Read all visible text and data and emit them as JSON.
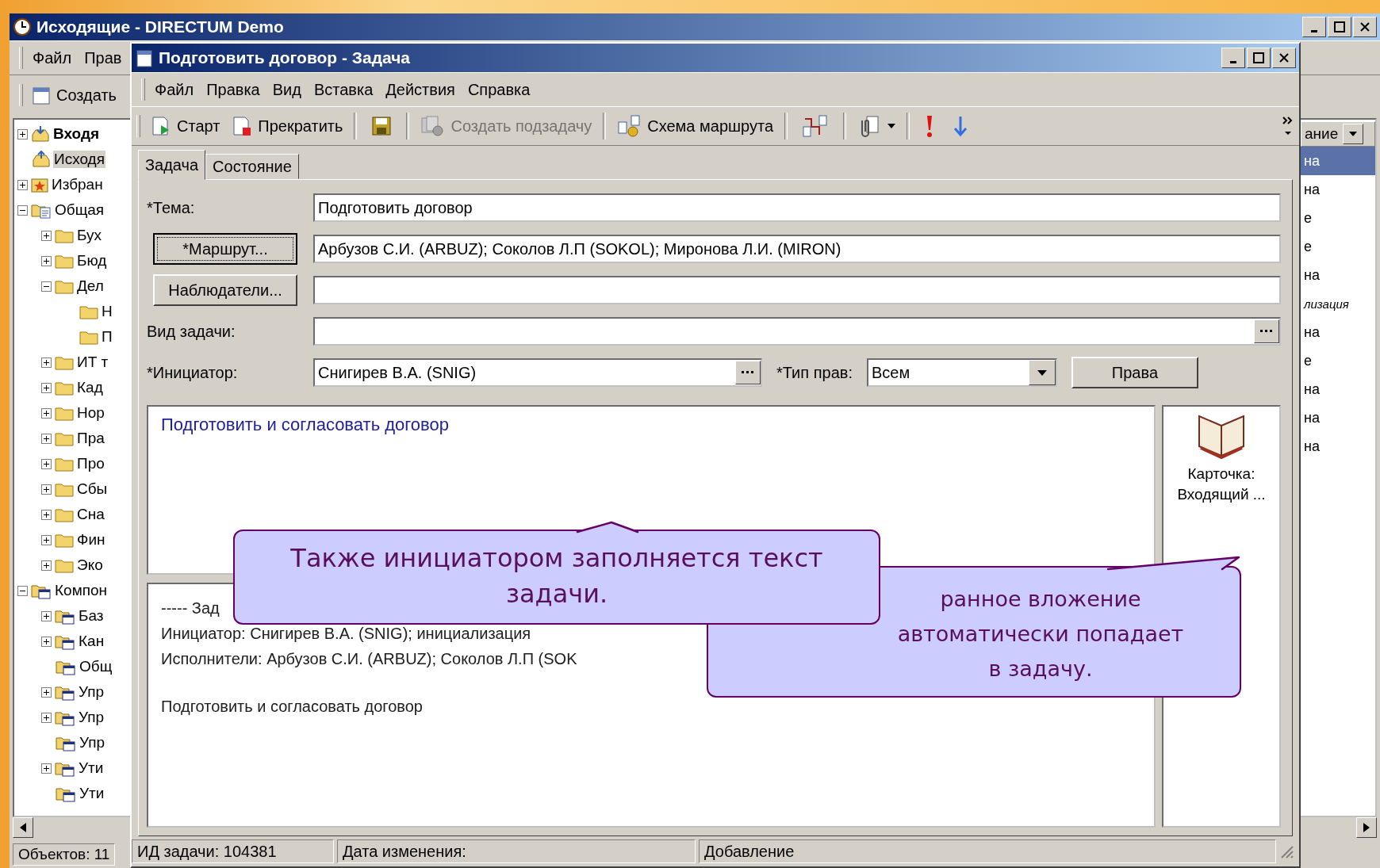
{
  "main_window": {
    "title": "Исходящие - DIRECTUM Demo",
    "menu": [
      "Файл",
      "Прав"
    ],
    "toolbar_button": "Создать",
    "tree": [
      {
        "label": "Входя",
        "kind": "inbox",
        "expanded": false,
        "bold": true,
        "selected": false
      },
      {
        "label": "Исходя",
        "kind": "outbox",
        "bold": false,
        "selected": true
      },
      {
        "label": "Избран",
        "kind": "favorites",
        "expanded": false,
        "bold": false,
        "selected": false
      },
      {
        "label": "Общая",
        "kind": "shared",
        "expanded": true,
        "bold": false,
        "selected": false,
        "children": [
          {
            "label": "Бух",
            "kind": "folder",
            "expanded": false,
            "bold": false,
            "selected": false
          },
          {
            "label": "Бюд",
            "kind": "folder",
            "expanded": false,
            "bold": false,
            "selected": false
          },
          {
            "label": "Дел",
            "kind": "folder",
            "expanded": true,
            "bold": false,
            "selected": false,
            "children": [
              {
                "label": "Н",
                "kind": "folder",
                "bold": false,
                "selected": false
              },
              {
                "label": "П",
                "kind": "folder",
                "bold": false,
                "selected": false
              }
            ]
          },
          {
            "label": "ИТ т",
            "kind": "folder",
            "expanded": false,
            "bold": false,
            "selected": false
          },
          {
            "label": "Кад",
            "kind": "folder",
            "expanded": false,
            "bold": false,
            "selected": false
          },
          {
            "label": "Нор",
            "kind": "folder",
            "expanded": false,
            "bold": false,
            "selected": false
          },
          {
            "label": "Пра",
            "kind": "folder",
            "expanded": false,
            "bold": false,
            "selected": false
          },
          {
            "label": "Про",
            "kind": "folder",
            "expanded": false,
            "bold": false,
            "selected": false
          },
          {
            "label": "Сбы",
            "kind": "folder",
            "expanded": false,
            "bold": false,
            "selected": false
          },
          {
            "label": "Сна",
            "kind": "folder",
            "expanded": false,
            "bold": false,
            "selected": false
          },
          {
            "label": "Фин",
            "kind": "folder",
            "expanded": false,
            "bold": false,
            "selected": false
          },
          {
            "label": "Эко",
            "kind": "folder",
            "expanded": false,
            "bold": false,
            "selected": false
          }
        ]
      },
      {
        "label": "Компон",
        "kind": "component",
        "expanded": true,
        "bold": false,
        "selected": false,
        "children": [
          {
            "label": "Баз",
            "kind": "component",
            "expanded": false,
            "bold": false,
            "selected": false
          },
          {
            "label": "Кан",
            "kind": "component",
            "expanded": false,
            "bold": false,
            "selected": false
          },
          {
            "label": "Общ",
            "kind": "component",
            "bold": false,
            "selected": false
          },
          {
            "label": "Упр",
            "kind": "component",
            "expanded": false,
            "bold": false,
            "selected": false
          },
          {
            "label": "Упр",
            "kind": "component",
            "expanded": false,
            "bold": false,
            "selected": false
          },
          {
            "label": "Упр",
            "kind": "component",
            "bold": false,
            "selected": false
          },
          {
            "label": "Ути",
            "kind": "component",
            "expanded": false,
            "bold": false,
            "selected": false
          },
          {
            "label": "Ути",
            "kind": "component",
            "bold": false,
            "selected": false
          }
        ]
      }
    ],
    "list": {
      "column_header": "ание",
      "rows": [
        {
          "text": "на",
          "selected": true,
          "italic": false
        },
        {
          "text": "на",
          "selected": false,
          "italic": false
        },
        {
          "text": "е",
          "selected": false,
          "italic": false
        },
        {
          "text": "е",
          "selected": false,
          "italic": false
        },
        {
          "text": "на",
          "selected": false,
          "italic": false
        },
        {
          "text": "лизация",
          "selected": false,
          "italic": true
        },
        {
          "text": "на",
          "selected": false,
          "italic": false
        },
        {
          "text": "е",
          "selected": false,
          "italic": false
        },
        {
          "text": "на",
          "selected": false,
          "italic": false
        },
        {
          "text": "на",
          "selected": false,
          "italic": false
        },
        {
          "text": "на",
          "selected": false,
          "italic": false
        }
      ]
    },
    "status": "Объектов: 11"
  },
  "task_window": {
    "title": "Подготовить договор - Задача",
    "menu": [
      "Файл",
      "Правка",
      "Вид",
      "Вставка",
      "Действия",
      "Справка"
    ],
    "toolbar": [
      {
        "kind": "button",
        "label": "Старт",
        "disabled": false
      },
      {
        "kind": "button",
        "label": "Прекратить",
        "disabled": false
      },
      {
        "kind": "separator"
      },
      {
        "kind": "icon",
        "disabled": false
      },
      {
        "kind": "separator"
      },
      {
        "kind": "button",
        "label": "Создать подзадачу",
        "disabled": true
      },
      {
        "kind": "separator"
      },
      {
        "kind": "button",
        "label": "Схема маршрута",
        "disabled": false
      },
      {
        "kind": "separator"
      },
      {
        "kind": "icon",
        "disabled": false
      },
      {
        "kind": "separator"
      },
      {
        "kind": "dropdown",
        "disabled": false
      },
      {
        "kind": "separator"
      },
      {
        "kind": "icon",
        "disabled": false
      },
      {
        "kind": "icon",
        "disabled": false
      }
    ],
    "tabs": [
      {
        "label": "Задача",
        "selected": true
      },
      {
        "label": "Состояние",
        "selected": false
      }
    ],
    "form": {
      "subject_label": "*Тема:",
      "subject": "Подготовить договор",
      "route_button": "*Маршрут...",
      "route": "Арбузов С.И. (ARBUZ); Соколов Л.П (SOKOL); Миронова Л.И. (MIRON)",
      "observers_button": "Наблюдатели...",
      "task_type_label": "Вид задачи:",
      "initiator_label": "*Инициатор:",
      "initiator": "Снигирев В.А. (SNIG)",
      "rights_type_label": "*Тип прав:",
      "rights_type": "Всем",
      "rights_button": "Права"
    },
    "body_text": "Подготовить и согласовать договор",
    "history": [
      {
        "text": "----- Зад"
      },
      {
        "text": "Инициатор: Снигирев В.А. (SNIG); инициализация"
      },
      {
        "text": "Исполнители: Арбузов С.И. (ARBUZ); Соколов Л.П (SOK"
      },
      {
        "text": "Подготовить и согласовать договор",
        "gap_before": true
      }
    ],
    "attachment": "Карточка: Входящий ...",
    "status_bar": [
      "ИД задачи: 104381",
      "Дата изменения:",
      "Добавление"
    ]
  },
  "callouts": [
    {
      "text": "Также инициатором заполняется текст задачи.",
      "kind": "tail_up"
    },
    {
      "text": "ранное вложение автоматически попадает в задачу.",
      "kind": "tail_right"
    }
  ]
}
